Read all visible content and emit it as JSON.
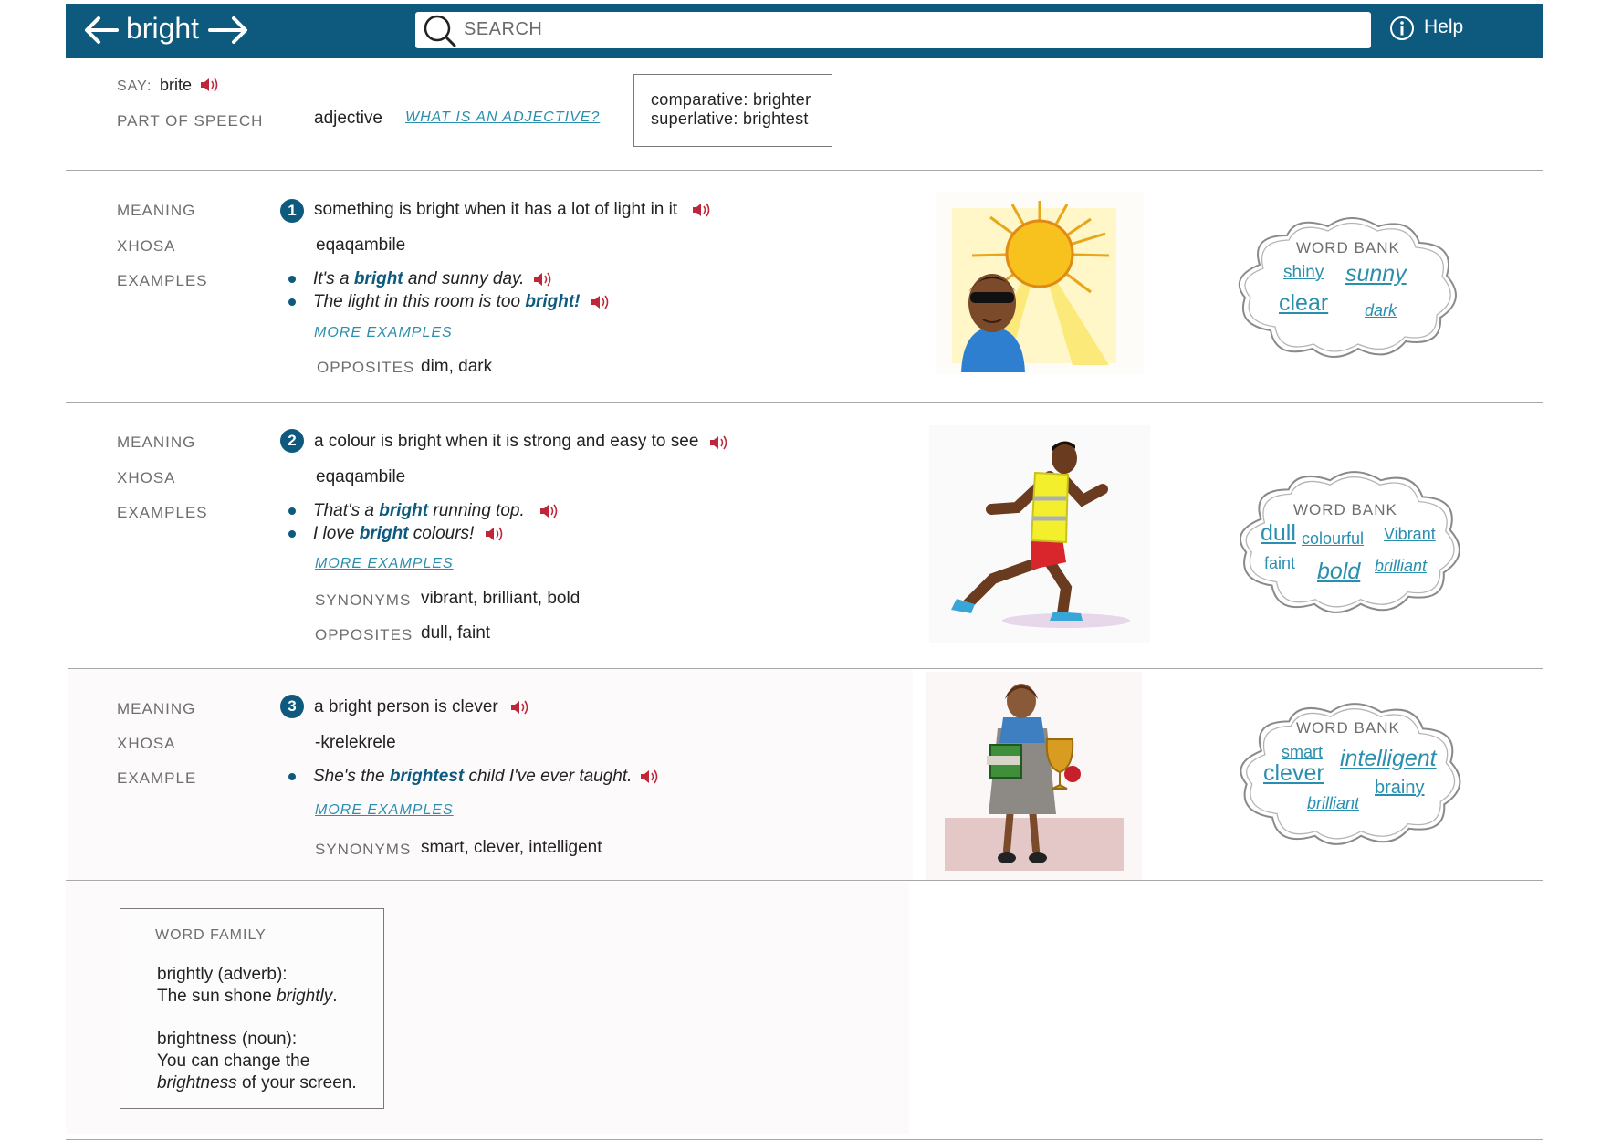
{
  "header": {
    "word": "bright",
    "search_placeholder": "SEARCH",
    "help_label": "Help",
    "icons": [
      "back-arrow-icon",
      "forward-arrow-icon",
      "search-icon",
      "info-icon"
    ],
    "colors": {
      "bar": "#0d5a7e",
      "link": "#2a8fae",
      "speaker": "#c0263a"
    }
  },
  "pronunciation": {
    "label": "SAY:",
    "value": "brite"
  },
  "part_of_speech": {
    "label": "PART OF SPEECH",
    "value": "adjective",
    "link": "WHAT IS AN ADJECTIVE?"
  },
  "forms": {
    "comparative": "comparative: brighter",
    "superlative": "superlative: brightest"
  },
  "senses": [
    {
      "number": "1",
      "meaning_label": "MEANING",
      "meaning": "something is bright when it has a lot of light in it",
      "xhosa_label": "XHOSA",
      "xhosa": "eqaqambile",
      "examples_label": "EXAMPLES",
      "examples": [
        {
          "pre": "It's a ",
          "bold": "bright",
          "post": " and sunny day."
        },
        {
          "pre": "The light in this room is too ",
          "bold": "bright!",
          "post": ""
        }
      ],
      "more_examples": "MORE EXAMPLES",
      "opposites_label": "OPPOSITES",
      "opposites": "dim, dark",
      "word_bank": {
        "title": "WORD BANK",
        "words": [
          "shiny",
          "sunny",
          "clear",
          "dark"
        ]
      }
    },
    {
      "number": "2",
      "meaning_label": "MEANING",
      "meaning": "a colour is bright when it is strong and easy to see",
      "xhosa_label": "XHOSA",
      "xhosa": "eqaqambile",
      "examples_label": "EXAMPLES",
      "examples": [
        {
          "pre": "That's a ",
          "bold": "bright",
          "post": " running top."
        },
        {
          "pre": "I love ",
          "bold": "bright",
          "post": " colours!"
        }
      ],
      "more_examples": "MORE EXAMPLES",
      "synonyms_label": "SYNONYMS",
      "synonyms": "vibrant, brilliant, bold",
      "opposites_label": "OPPOSITES",
      "opposites": "dull, faint",
      "word_bank": {
        "title": "WORD BANK",
        "words": [
          "dull",
          "colourful",
          "Vibrant",
          "faint",
          "bold",
          "brilliant"
        ]
      }
    },
    {
      "number": "3",
      "meaning_label": "MEANING",
      "meaning": "a bright person is clever",
      "xhosa_label": "XHOSA",
      "xhosa": "-krelekrele",
      "examples_label": "EXAMPLE",
      "examples": [
        {
          "pre": "She's the ",
          "bold": "brightest",
          "post": " child I've ever taught."
        }
      ],
      "more_examples": "MORE EXAMPLES",
      "synonyms_label": "SYNONYMS",
      "synonyms": "smart, clever, intelligent",
      "word_bank": {
        "title": "WORD BANK",
        "words": [
          "smart",
          "intelligent",
          "clever",
          "brainy",
          "brilliant"
        ]
      }
    }
  ],
  "word_family": {
    "title": "WORD FAMILY",
    "entry1_head": "brightly (adverb):",
    "entry1_pre": "The sun shone ",
    "entry1_bold": "brightly",
    "entry1_post": ".",
    "entry2_head": "brightness (noun):",
    "entry2_line1": "You can change the",
    "entry2_bold": "brightness",
    "entry2_post": " of your screen."
  }
}
